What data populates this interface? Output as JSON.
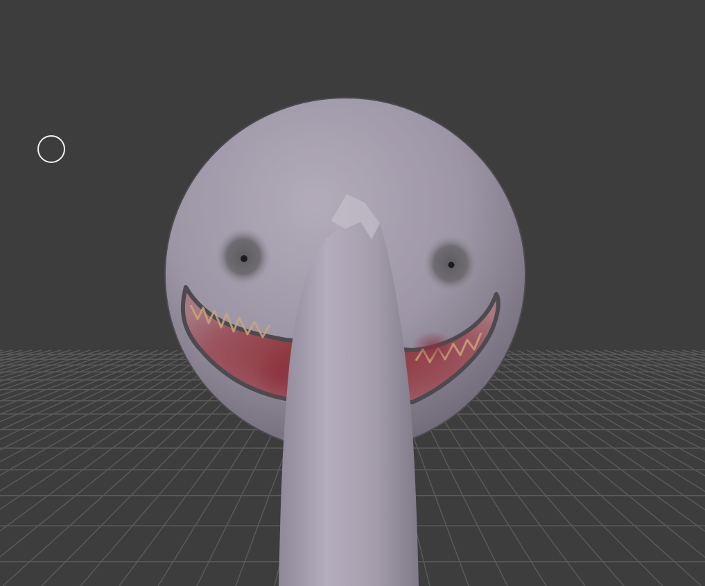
{
  "viewport": {
    "background_color": "#3d3d3d",
    "grid_line_color": "#5a5a5a",
    "model_color": "#a8a1b0",
    "accent_color": "#8a2a2e",
    "cursor_icon": "circle-brush-cursor-icon"
  }
}
